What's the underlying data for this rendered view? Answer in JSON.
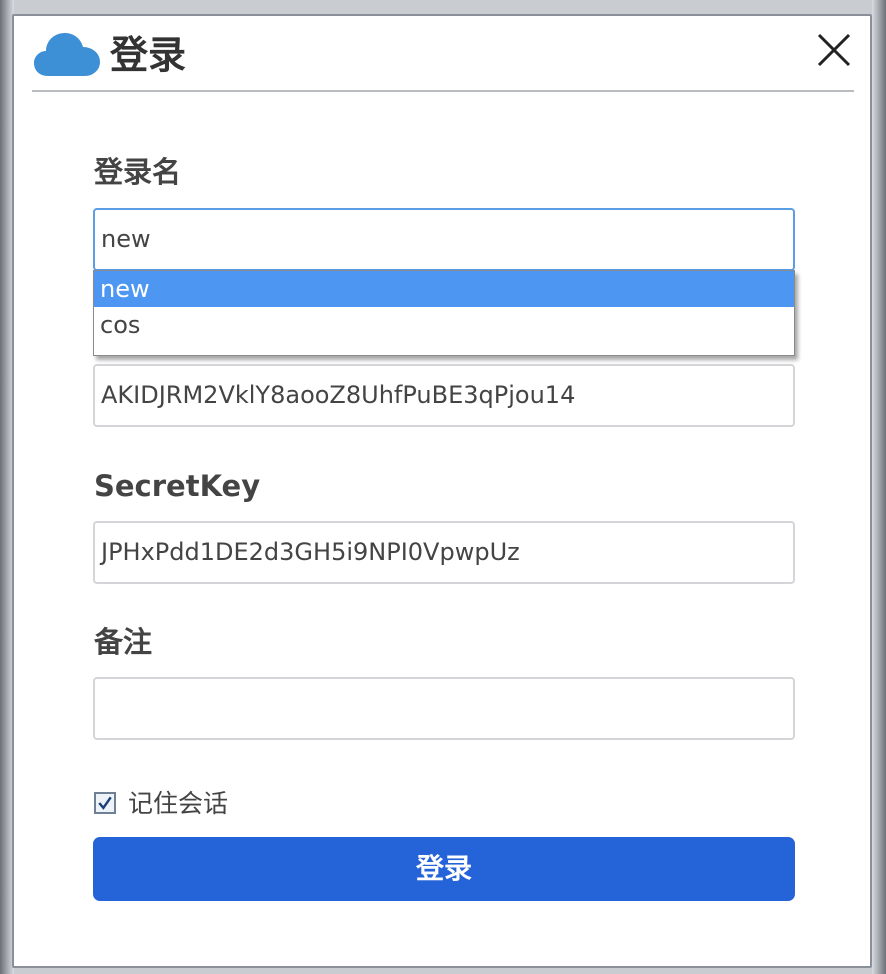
{
  "dialog": {
    "title": "登录",
    "icon": "cloud-icon",
    "close_icon": "close-icon"
  },
  "form": {
    "login_name": {
      "label": "登录名",
      "value": "new",
      "dropdown_options": [
        "new",
        "cos"
      ],
      "selected_option": "new"
    },
    "secret_id": {
      "value": "AKIDJRM2VklY8aooZ8UhfPuBE3qPjou14"
    },
    "secret_key": {
      "label": "SecretKey",
      "value": "JPHxPdd1DE2d3GH5i9NPI0VpwpUz"
    },
    "remark": {
      "label": "备注",
      "value": ""
    },
    "remember_session": {
      "label": "记住会话",
      "checked": true
    },
    "submit_label": "登录"
  },
  "colors": {
    "accent": "#2563d8",
    "dropdown_selected": "#4d97f2",
    "cloud": "#3d8fd6",
    "focus_border": "#5b9ee6"
  }
}
